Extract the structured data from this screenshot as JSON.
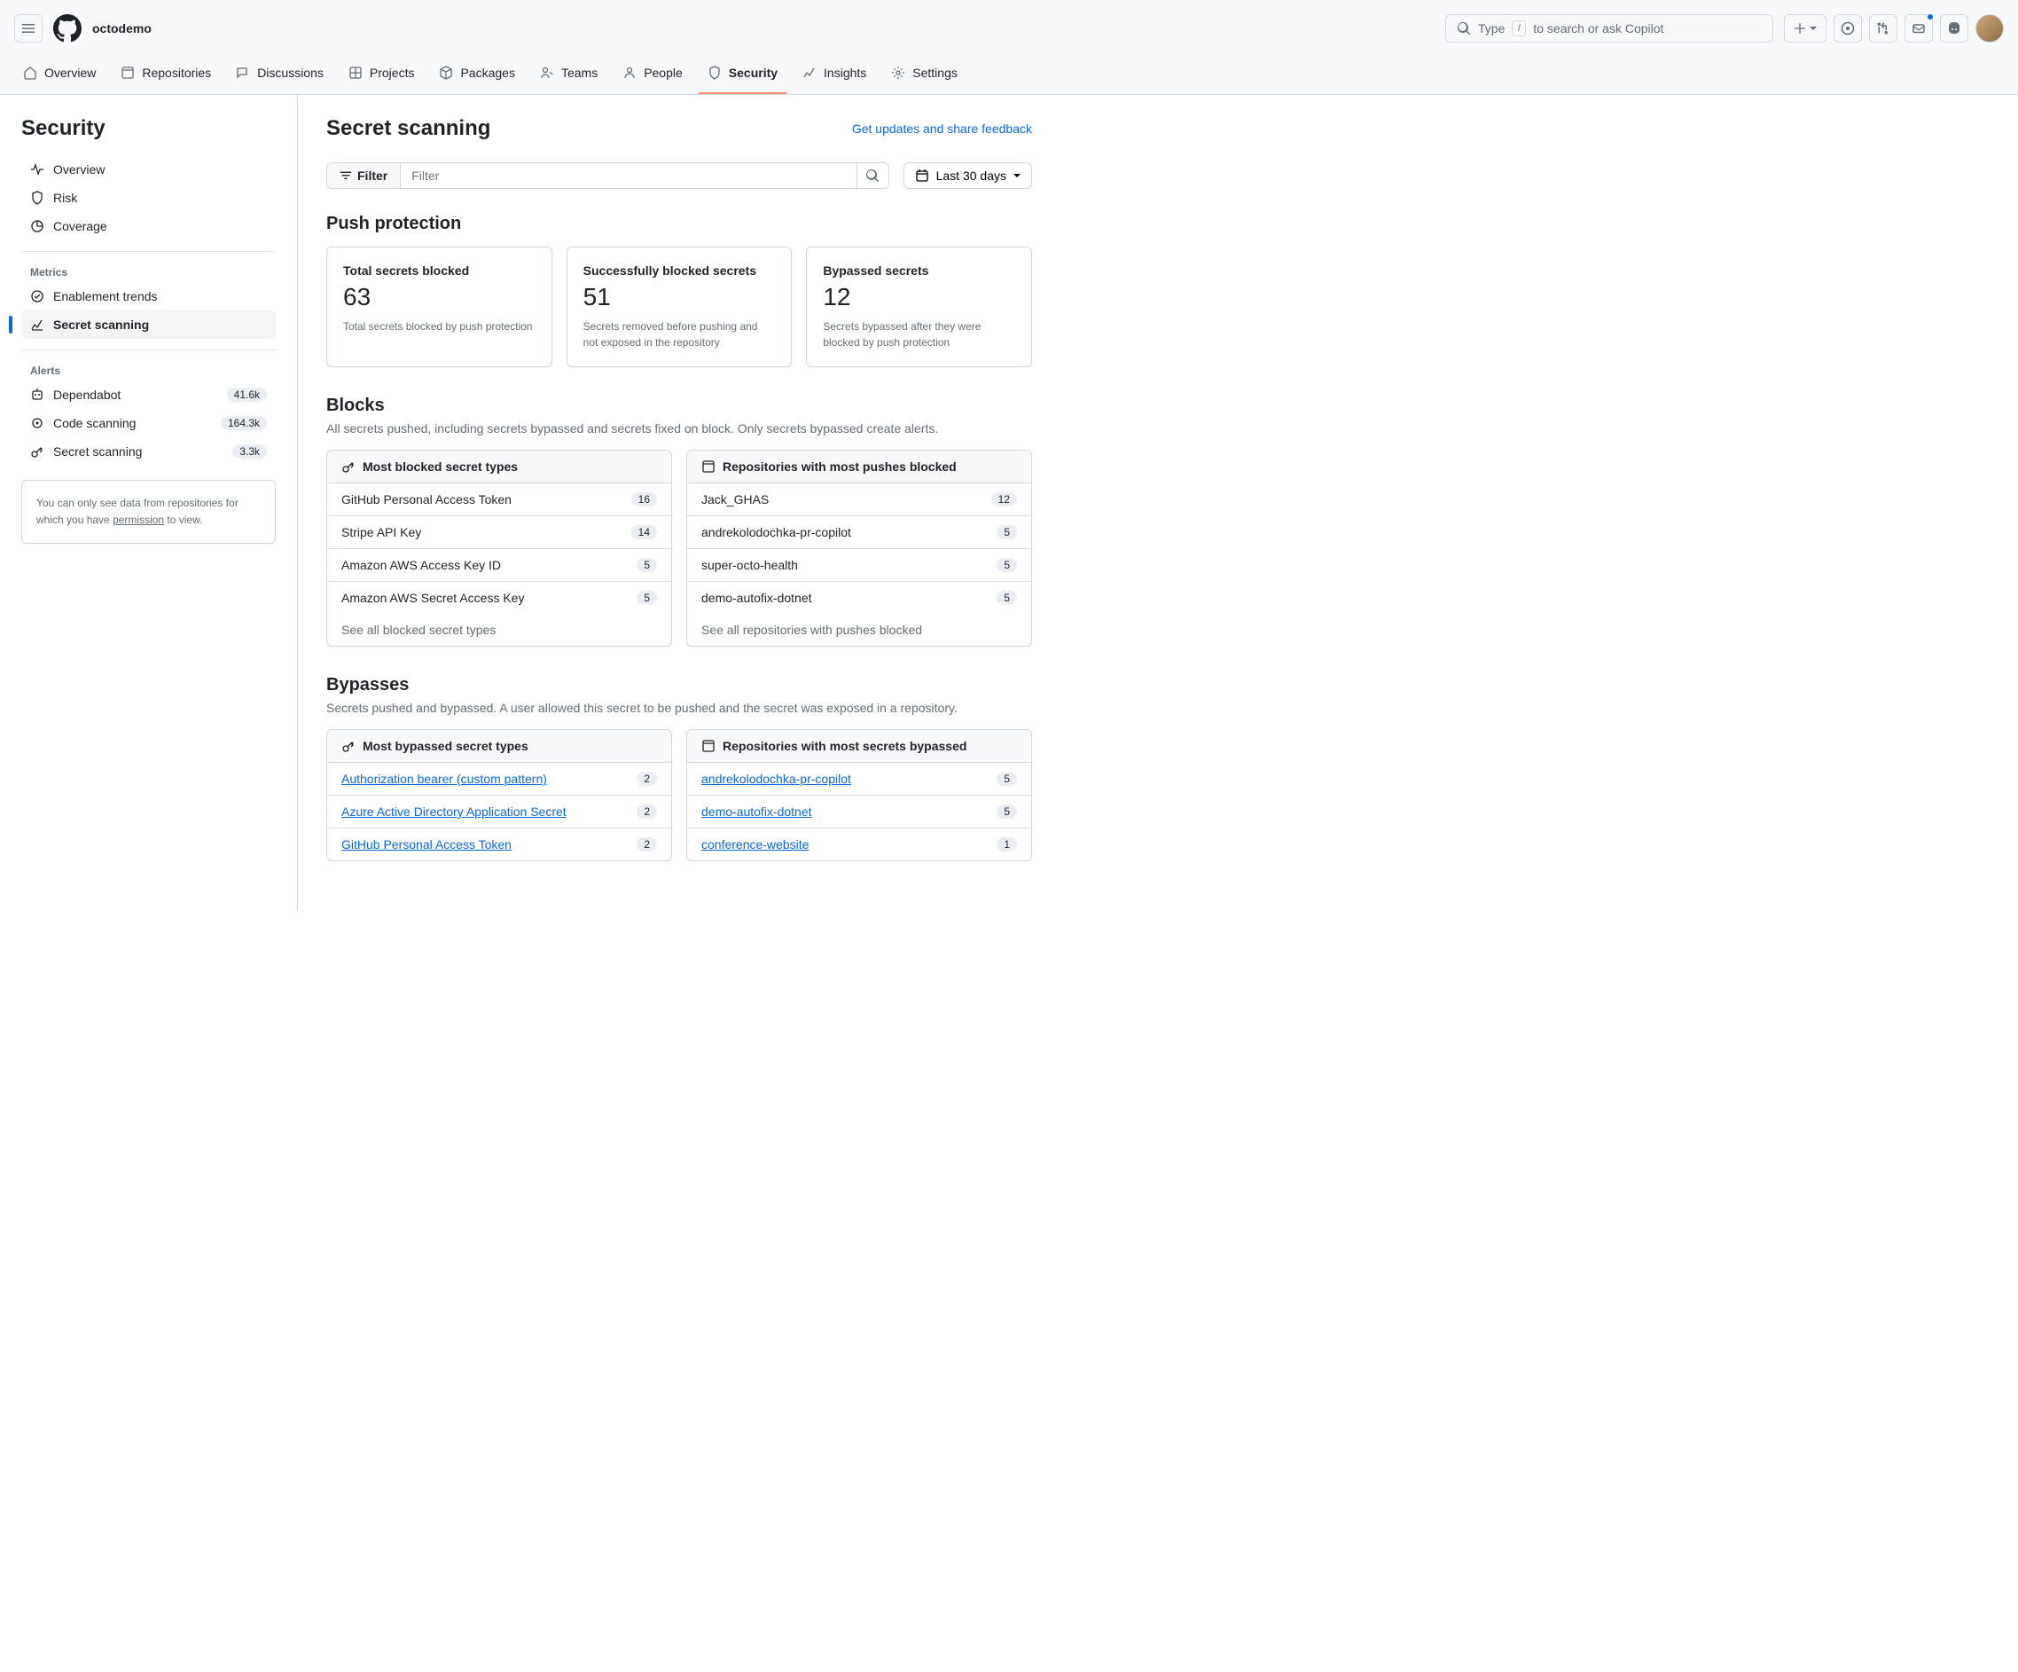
{
  "header": {
    "org": "octodemo",
    "search_placeholder_prefix": "Type",
    "search_placeholder_suffix": "to search or ask Copilot"
  },
  "nav": {
    "items": [
      {
        "label": "Overview"
      },
      {
        "label": "Repositories"
      },
      {
        "label": "Discussions"
      },
      {
        "label": "Projects"
      },
      {
        "label": "Packages"
      },
      {
        "label": "Teams"
      },
      {
        "label": "People"
      },
      {
        "label": "Security",
        "active": true
      },
      {
        "label": "Insights"
      },
      {
        "label": "Settings"
      }
    ]
  },
  "sidebar": {
    "title": "Security",
    "top": [
      {
        "label": "Overview"
      },
      {
        "label": "Risk"
      },
      {
        "label": "Coverage"
      }
    ],
    "section_metrics": "Metrics",
    "metrics": [
      {
        "label": "Enablement trends"
      },
      {
        "label": "Secret scanning",
        "active": true
      }
    ],
    "section_alerts": "Alerts",
    "alerts": [
      {
        "label": "Dependabot",
        "count": "41.6k"
      },
      {
        "label": "Code scanning",
        "count": "164.3k"
      },
      {
        "label": "Secret scanning",
        "count": "3.3k"
      }
    ],
    "info_prefix": "You can only see data from repositories for which you have ",
    "info_link": "permission",
    "info_suffix": " to view."
  },
  "main": {
    "title": "Secret scanning",
    "feedback": "Get updates and share feedback",
    "filter_label": "Filter",
    "filter_placeholder": "Filter",
    "date_range": "Last 30 days",
    "push_protection": {
      "heading": "Push protection",
      "cards": [
        {
          "label": "Total secrets blocked",
          "value": "63",
          "desc": "Total secrets blocked by push protection"
        },
        {
          "label": "Successfully blocked secrets",
          "value": "51",
          "desc": "Secrets removed before pushing and not exposed in the repository"
        },
        {
          "label": "Bypassed secrets",
          "value": "12",
          "desc": "Secrets bypassed after they were blocked by push protection"
        }
      ]
    },
    "blocks": {
      "heading": "Blocks",
      "sub": "All secrets pushed, including secrets bypassed and secrets fixed on block. Only secrets bypassed create alerts.",
      "left_title": "Most blocked secret types",
      "left_items": [
        {
          "label": "GitHub Personal Access Token",
          "count": "16"
        },
        {
          "label": "Stripe API Key",
          "count": "14"
        },
        {
          "label": "Amazon AWS Access Key ID",
          "count": "5"
        },
        {
          "label": "Amazon AWS Secret Access Key",
          "count": "5"
        }
      ],
      "left_footer": "See all blocked secret types",
      "right_title": "Repositories with most pushes blocked",
      "right_items": [
        {
          "label": "Jack_GHAS",
          "count": "12"
        },
        {
          "label": "andrekolodochka-pr-copilot",
          "count": "5"
        },
        {
          "label": "super-octo-health",
          "count": "5"
        },
        {
          "label": "demo-autofix-dotnet",
          "count": "5"
        }
      ],
      "right_footer": "See all repositories with pushes blocked"
    },
    "bypasses": {
      "heading": "Bypasses",
      "sub": "Secrets pushed and bypassed. A user allowed this secret to be pushed and the secret was exposed in a repository.",
      "left_title": "Most bypassed secret types",
      "left_items": [
        {
          "label": "Authorization bearer (custom pattern)",
          "count": "2"
        },
        {
          "label": "Azure Active Directory Application Secret",
          "count": "2"
        },
        {
          "label": "GitHub Personal Access Token",
          "count": "2"
        }
      ],
      "right_title": "Repositories with most secrets bypassed",
      "right_items": [
        {
          "label": "andrekolodochka-pr-copilot",
          "count": "5"
        },
        {
          "label": "demo-autofix-dotnet",
          "count": "5"
        },
        {
          "label": "conference-website",
          "count": "1"
        }
      ]
    }
  }
}
